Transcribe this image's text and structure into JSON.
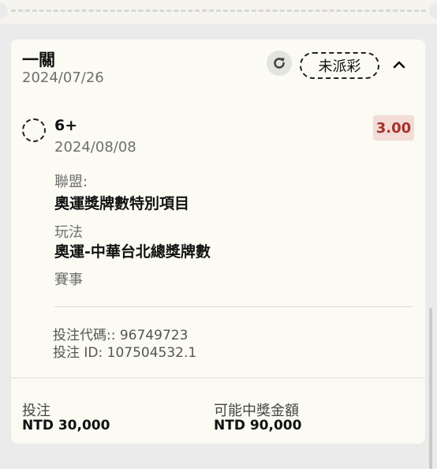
{
  "ticket": {
    "title": "一關",
    "date": "2024/07/26",
    "status": "未派彩"
  },
  "selection": {
    "name": "6+",
    "date": "2024/08/08",
    "odds": "3.00",
    "league_label": "聯盟:",
    "league_value": "奧運獎牌數特別項目",
    "market_label": "玩法",
    "market_value": "奧運-中華台北總獎牌數",
    "event_label": "賽事",
    "bet_code": "投注代碼:: 96749723",
    "bet_id": "投注 ID: 107504532.1"
  },
  "footer": {
    "stake_label": "投注",
    "stake_value": "NTD 30,000",
    "payout_label": "可能中獎金額",
    "payout_value": "NTD 90,000"
  },
  "icons": {
    "refresh": "refresh-icon",
    "collapse": "chevron-up-icon"
  }
}
